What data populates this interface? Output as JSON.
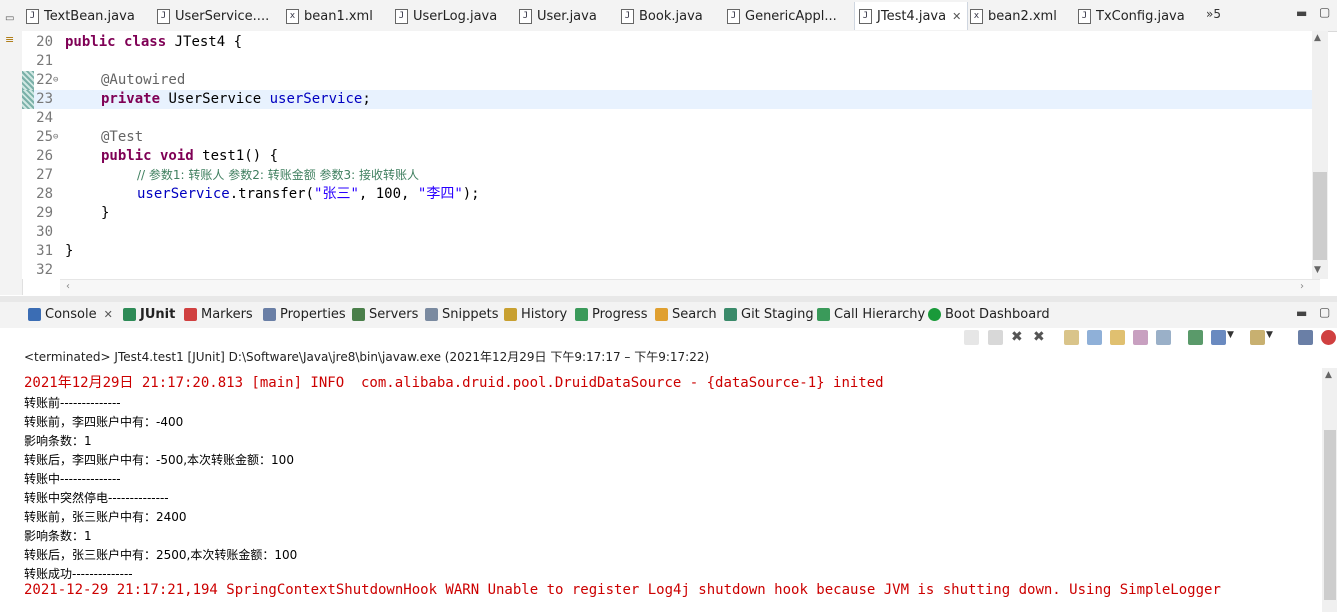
{
  "editor_tabs": [
    {
      "label": "TextBean.java",
      "icon": "J"
    },
    {
      "label": "UserService....",
      "icon": "J"
    },
    {
      "label": "bean1.xml",
      "icon": "x"
    },
    {
      "label": "UserLog.java",
      "icon": "J"
    },
    {
      "label": "User.java",
      "icon": "J"
    },
    {
      "label": "Book.java",
      "icon": "J"
    },
    {
      "label": "GenericAppl...",
      "icon": "J"
    },
    {
      "label": "JTest4.java",
      "icon": "J",
      "close": "✕"
    },
    {
      "label": "bean2.xml",
      "icon": "x"
    },
    {
      "label": "TxConfig.java",
      "icon": "J"
    }
  ],
  "tab_overflow": "»5",
  "line_numbers": [
    "20",
    "21",
    "22",
    "23",
    "24",
    "25",
    "26",
    "27",
    "28",
    "29",
    "30",
    "31",
    "32"
  ],
  "code": {
    "l20a": "public class",
    "l20b": " JTest4 {",
    "l22": "@Autowired",
    "l23a": "private",
    "l23b": " UserService ",
    "l23c": "userService",
    "l23d": ";",
    "l25": "@Test",
    "l26a": "public void",
    "l26b": " test1() {",
    "l27": "// 参数1: 转账人 参数2: 转账金额 参数3: 接收转账人",
    "l28a": "userService",
    "l28b": ".transfer(",
    "l28c": "\"张三\"",
    "l28d": ", 100, ",
    "l28e": "\"李四\"",
    "l28f": ");",
    "l29": "}",
    "l31": "}"
  },
  "view_tabs": [
    {
      "label": "Console",
      "icon_color": "#3b6db4",
      "close": "✕"
    },
    {
      "label": "JUnit",
      "icon_color": "#2e8b57",
      "bold": true
    },
    {
      "label": "Markers",
      "icon_color": "#d04040"
    },
    {
      "label": "Properties",
      "icon_color": "#6a7fa6"
    },
    {
      "label": "Servers",
      "icon_color": "#4a7f4a"
    },
    {
      "label": "Snippets",
      "icon_color": "#7a8aa0"
    },
    {
      "label": "History",
      "icon_color": "#c8a030"
    },
    {
      "label": "Progress",
      "icon_color": "#3a9a5a"
    },
    {
      "label": "Search",
      "icon_color": "#e0a030"
    },
    {
      "label": "Git Staging",
      "icon_color": "#3a8a6a"
    },
    {
      "label": "Call Hierarchy",
      "icon_color": "#3a9a5a"
    },
    {
      "label": "Boot Dashboard",
      "icon_color": "#1a9a3a"
    }
  ],
  "console_status": "<terminated> JTest4.test1 [JUnit] D:\\Software\\Java\\jre8\\bin\\javaw.exe  (2021年12月29日 下午9:17:17 – 下午9:17:22)",
  "console_lines": [
    {
      "text": "2021年12月29日 21:17:20.813 [main] INFO  com.alibaba.druid.pool.DruidDataSource - {dataSource-1} inited",
      "style": "red mono"
    },
    {
      "text": "转账前--------------",
      "style": "cn"
    },
    {
      "text": "转账前，李四账户中有：-400",
      "style": "cn"
    },
    {
      "text": "影响条数：1",
      "style": "cn"
    },
    {
      "text": "转账后，李四账户中有：-500,本次转账金额：100",
      "style": "cn"
    },
    {
      "text": "转账中--------------",
      "style": "cn"
    },
    {
      "text": "转账中突然停电--------------",
      "style": "cn"
    },
    {
      "text": "转账前，张三账户中有：2400",
      "style": "cn"
    },
    {
      "text": "影响条数：1",
      "style": "cn"
    },
    {
      "text": "转账后，张三账户中有：2500,本次转账金额：100",
      "style": "cn"
    },
    {
      "text": "转账成功--------------",
      "style": "cn"
    },
    {
      "text": "2021-12-29 21:17:21,194 SpringContextShutdownHook WARN Unable to register Log4j shutdown hook because JVM is shutting down. Using SimpleLogger",
      "style": "red mono"
    }
  ],
  "colors": {
    "keyword": "#7f0055",
    "field": "#0000c0",
    "string": "#2a00ff",
    "comment": "#3f7f5f",
    "annotation": "#646464",
    "stderr": "#cc0000",
    "current_line": "#e8f2fe"
  }
}
